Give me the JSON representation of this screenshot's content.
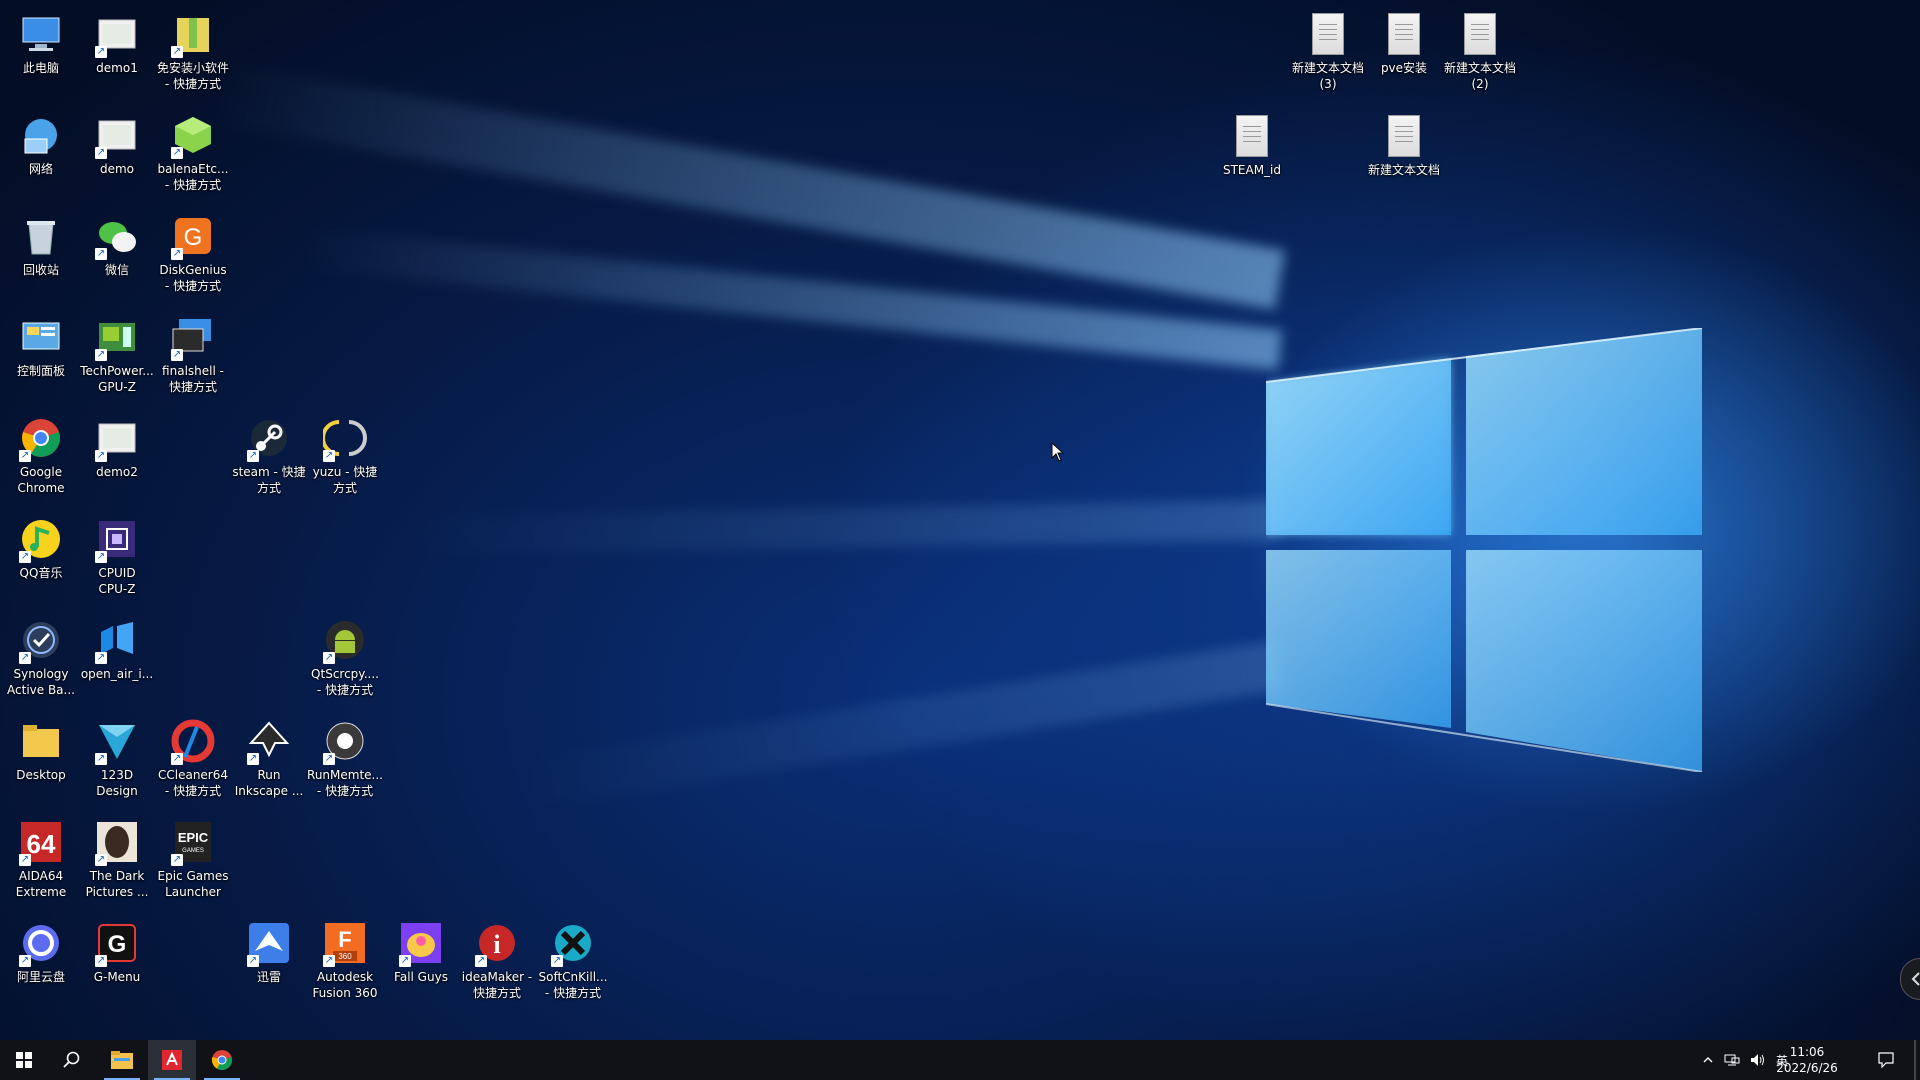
{
  "desktop": {
    "left_icons": [
      {
        "label": "此电脑",
        "icon": "computer-icon"
      },
      {
        "label": "demo1",
        "icon": "image-icon"
      },
      {
        "label": "免安装小软件\n- 快捷方式",
        "icon": "zip-folder-icon"
      },
      {
        "label": "网络",
        "icon": "network-icon"
      },
      {
        "label": "demo",
        "icon": "image-icon"
      },
      {
        "label": "balenaEtc...\n- 快捷方式",
        "icon": "balena-cube-icon"
      },
      {
        "label": "回收站",
        "icon": "recycle-bin-icon"
      },
      {
        "label": "微信",
        "icon": "wechat-icon"
      },
      {
        "label": "DiskGenius\n- 快捷方式",
        "icon": "diskgenius-icon"
      },
      {
        "label": "控制面板",
        "icon": "control-panel-icon"
      },
      {
        "label": "TechPower...\nGPU-Z",
        "icon": "gpu-z-icon"
      },
      {
        "label": "finalshell -\n快捷方式",
        "icon": "finalshell-icon"
      },
      {
        "label": "Google\nChrome",
        "icon": "chrome-icon"
      },
      {
        "label": "demo2",
        "icon": "image-icon"
      },
      {
        "label": "steam - 快捷\n方式",
        "icon": "steam-icon"
      },
      {
        "label": "yuzu - 快捷\n方式",
        "icon": "yuzu-icon"
      },
      {
        "label": "QQ音乐",
        "icon": "qq-music-icon"
      },
      {
        "label": "CPUID\nCPU-Z",
        "icon": "cpu-z-icon"
      },
      {
        "label": "Synology\nActive Ba...",
        "icon": "synology-icon"
      },
      {
        "label": "open_air_i...",
        "icon": "open-air-icon"
      },
      {
        "label": "QtScrcpy....\n- 快捷方式",
        "icon": "android-icon"
      },
      {
        "label": "Desktop",
        "icon": "folder-icon"
      },
      {
        "label": "123D\nDesign",
        "icon": "123d-design-icon"
      },
      {
        "label": "CCleaner64\n- 快捷方式",
        "icon": "ccleaner-icon"
      },
      {
        "label": "Run\nInkscape ...",
        "icon": "inkscape-icon"
      },
      {
        "label": "RunMemte...\n- 快捷方式",
        "icon": "memtest-icon"
      },
      {
        "label": "AIDA64\nExtreme",
        "icon": "aida64-icon"
      },
      {
        "label": "The Dark\nPictures ...",
        "icon": "dark-pictures-icon"
      },
      {
        "label": "Epic Games\nLauncher",
        "icon": "epic-games-icon"
      },
      {
        "label": "阿里云盘",
        "icon": "aliyun-drive-icon"
      },
      {
        "label": "G-Menu",
        "icon": "g-menu-icon"
      },
      {
        "label": "迅雷",
        "icon": "xunlei-icon"
      },
      {
        "label": "Autodesk\nFusion 360",
        "icon": "fusion360-icon"
      },
      {
        "label": "Fall Guys",
        "icon": "fall-guys-icon"
      },
      {
        "label": "ideaMaker -\n快捷方式",
        "icon": "ideamaker-icon"
      },
      {
        "label": "SoftCnKill...\n- 快捷方式",
        "icon": "softcnkill-icon"
      }
    ],
    "right_icons": [
      {
        "label": "新建文本文档\n(3)"
      },
      {
        "label": "pve安装"
      },
      {
        "label": "新建文本文档\n(2)"
      },
      {
        "label": "STEAM_id"
      },
      {
        "label": "新建文本文档"
      }
    ],
    "aida_text": "64",
    "epic_text": "EPIC",
    "epic_sub": "GAMES",
    "fusion_text": "F",
    "fusion_sub": "360",
    "gmenu_text": "G",
    "idea_text": "i"
  },
  "taskbar": {
    "clock_time": "11:06",
    "clock_date": "2022/6/26",
    "ime": "英"
  }
}
